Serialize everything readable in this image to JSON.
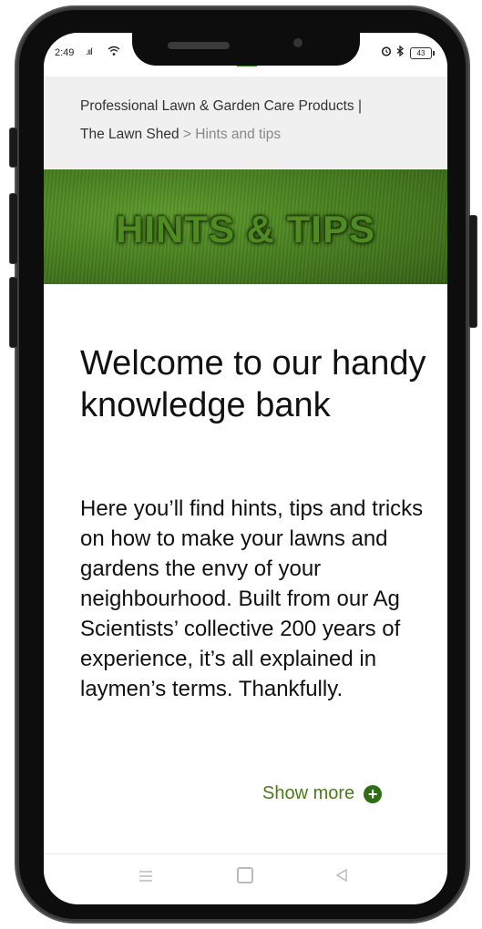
{
  "status_bar": {
    "time": "2:49",
    "signal": ".ııl",
    "battery": "43"
  },
  "breadcrumb": {
    "home_line1": "Professional Lawn & Garden Care Products |",
    "home_line2": "The Lawn Shed",
    "separator": ">",
    "current": "Hints and tips"
  },
  "banner": {
    "title": "HINTS & TIPS"
  },
  "main": {
    "heading": "Welcome to our handy knowledge bank",
    "body": "Here you’ll find hints, tips and tricks on how to make your lawns and gardens the envy of your neighbourhood. Built from our Ag Scientists’ collective 200 years of experience, it’s all explained in laymen’s terms. Thankfully.",
    "show_more_label": "Show more"
  },
  "colors": {
    "accent_green": "#4c7a15",
    "plus_icon_green": "#2f6d17",
    "breadcrumb_bg": "#f0f0f0"
  },
  "icons": {
    "wifi": "wifi-icon",
    "alarm": "alarm-icon",
    "bluetooth": "bluetooth-icon",
    "show_more": "plus-circle-icon",
    "nav_menu": "menu-icon",
    "nav_home": "home-square-icon",
    "nav_back": "back-triangle-icon"
  }
}
